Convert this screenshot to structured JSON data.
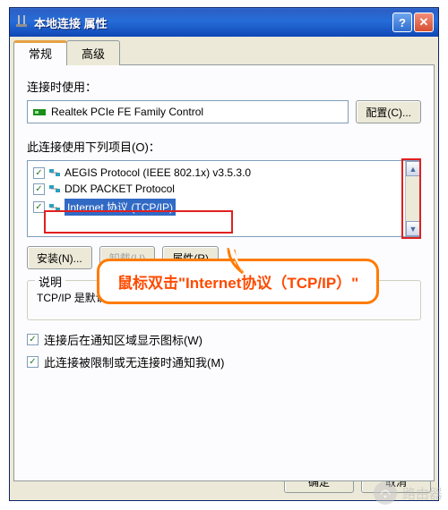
{
  "window": {
    "title": "本地连接 属性"
  },
  "tabs": {
    "general": "常规",
    "advanced": "高级"
  },
  "adapter": {
    "label": "连接时使用：",
    "name": "Realtek PCIe FE Family Control",
    "configure_btn": "配置(C)..."
  },
  "components": {
    "label": "此连接使用下列项目(O)：",
    "items": [
      {
        "checked": true,
        "text": "AEGIS Protocol (IEEE 802.1x) v3.5.3.0"
      },
      {
        "checked": true,
        "text": "DDK PACKET Protocol"
      },
      {
        "checked": true,
        "text": "Internet 协议 (TCP/IP)",
        "selected": true
      }
    ]
  },
  "buttons": {
    "install": "安装(N)...",
    "uninstall": "卸载(U)",
    "properties": "属性(R)"
  },
  "description": {
    "legend": "说明",
    "text": "TCP/IP 是默认的广域网协议。它提供跨越多种互联网络的通讯。"
  },
  "checkboxes": {
    "show_icon": "连接后在通知区域显示图标(W)",
    "notify": "此连接被限制或无连接时通知我(M)"
  },
  "footer": {
    "ok": "确定",
    "cancel": "取消"
  },
  "callout": {
    "text": "鼠标双击\"Internet协议（TCP/IP）\""
  },
  "watermark": "路由器",
  "scroll": {
    "up": "▲",
    "down": "▼"
  }
}
